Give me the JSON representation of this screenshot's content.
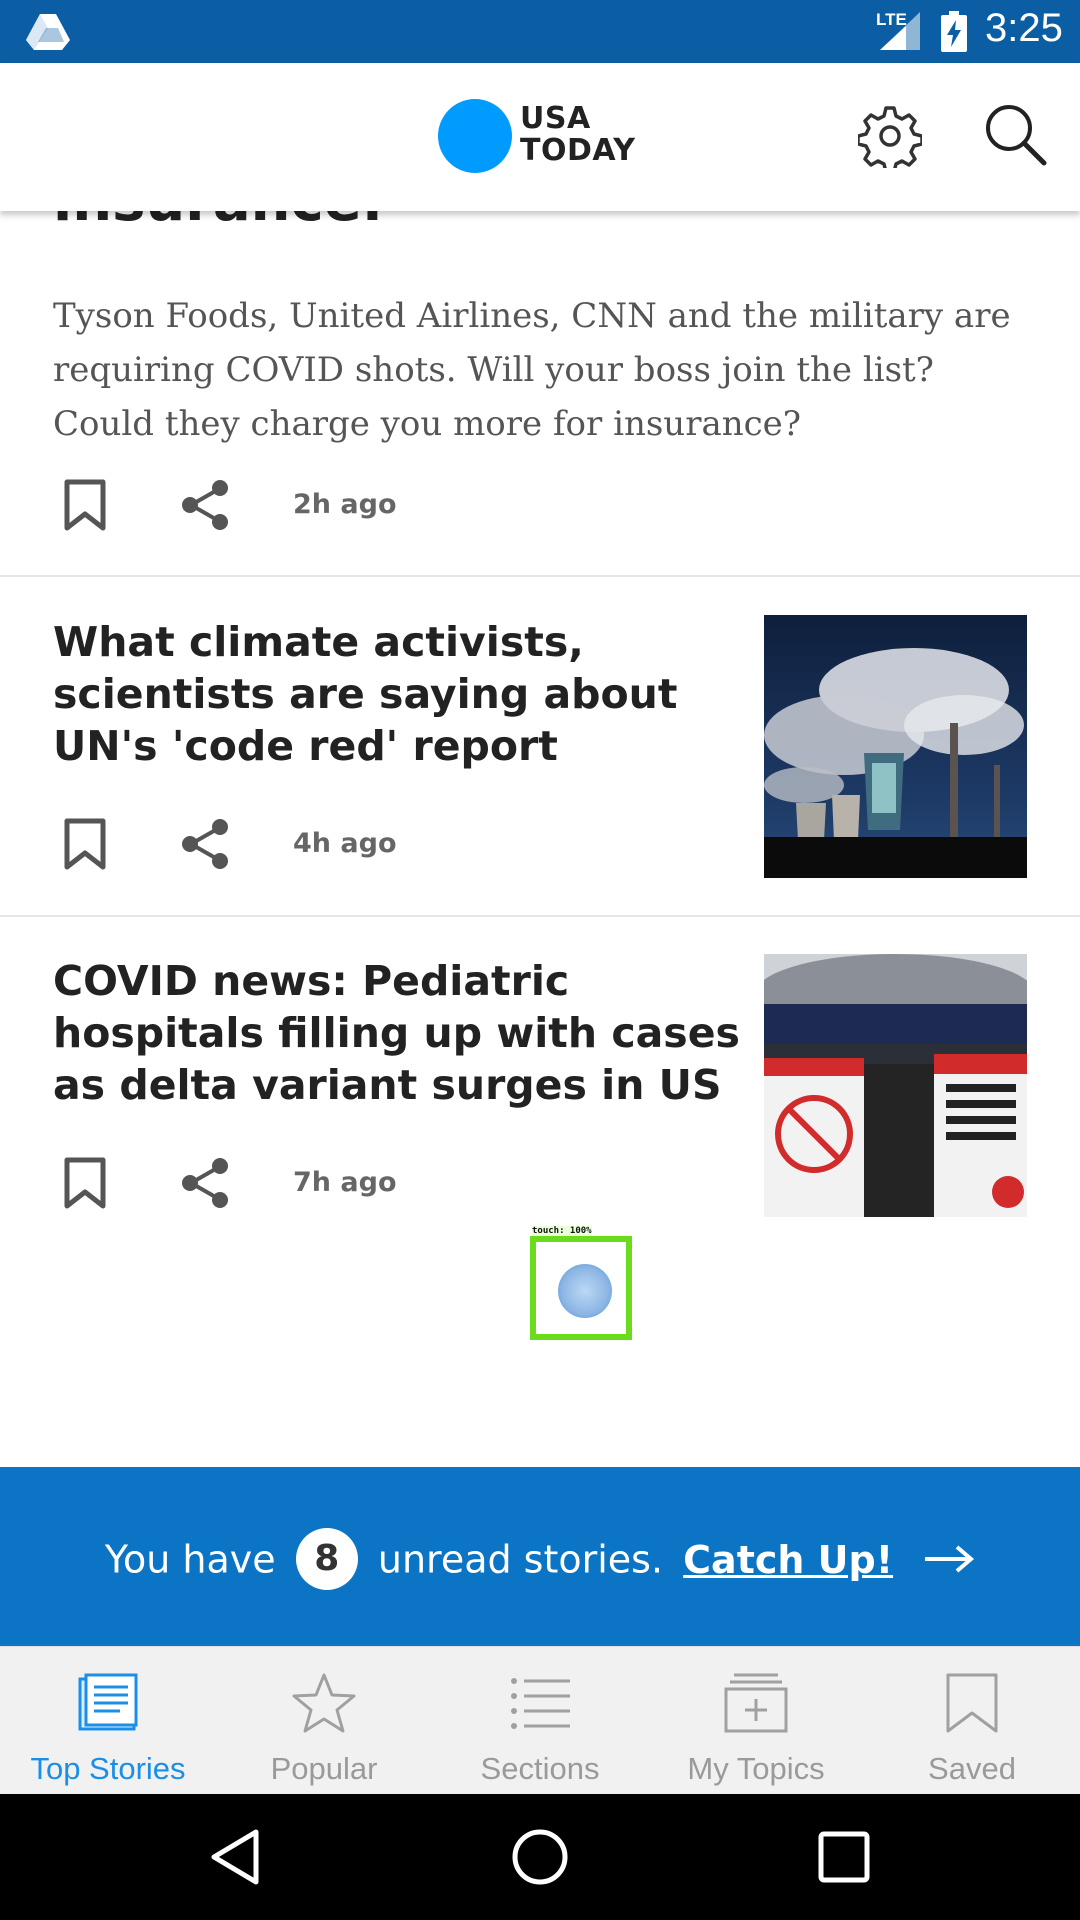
{
  "status_bar": {
    "time": "3:25",
    "network": "LTE",
    "icons": [
      "drive-icon",
      "signal-icon",
      "battery-charging-icon"
    ],
    "background_color": "#0b5ea3"
  },
  "header": {
    "logo_line1": "USA",
    "logo_line2": "TODAY",
    "logo_color": "#009bff",
    "icons": [
      "settings-icon",
      "search-icon"
    ]
  },
  "stories": [
    {
      "title_fragment": "insurance.",
      "summary": "Tyson Foods, United Airlines, CNN and the military are requiring COVID shots. Will your boss join the list? Could they charge you more for insurance?",
      "time_ago": "2h ago"
    },
    {
      "title": "What climate activists, scientists are saying about UN's 'code red' report",
      "time_ago": "4h ago",
      "thumbnail": "power-plant-climate-crisis-projection"
    },
    {
      "title": "COVID news: Pediatric hospitals filling up with cases as delta variant surges in US",
      "time_ago": "7h ago",
      "thumbnail": "attention-face-masks-sign"
    }
  ],
  "catch_up_banner": {
    "prefix": "You have",
    "count": "8",
    "suffix": "unread stories.",
    "link": "Catch Up!",
    "background_color": "#0b74c4"
  },
  "touch_overlay": {
    "label": "touch: 100%"
  },
  "bottom_nav": {
    "items": [
      {
        "label": "Top Stories",
        "icon": "top-stories-icon",
        "active": true
      },
      {
        "label": "Popular",
        "icon": "star-icon",
        "active": false
      },
      {
        "label": "Sections",
        "icon": "list-icon",
        "active": false
      },
      {
        "label": "My Topics",
        "icon": "my-topics-icon",
        "active": false
      },
      {
        "label": "Saved",
        "icon": "bookmark-icon",
        "active": false
      }
    ],
    "active_color": "#1b8fe6"
  },
  "system_nav": {
    "buttons": [
      "back-icon",
      "home-icon",
      "recents-icon"
    ]
  }
}
